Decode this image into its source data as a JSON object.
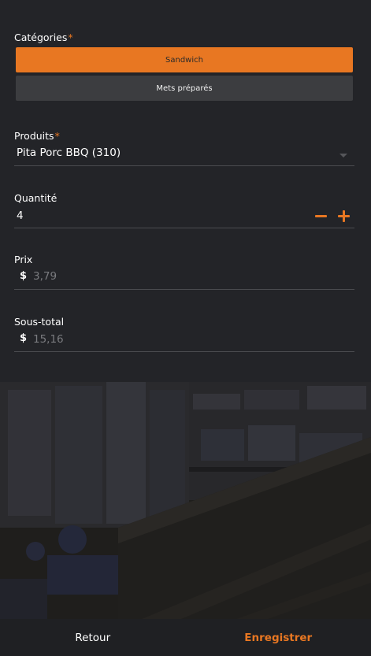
{
  "colors": {
    "accent": "#e87722",
    "background": "#232428",
    "inactive_button": "#3c3d40"
  },
  "categories": {
    "label": "Catégories",
    "required_mark": "*",
    "options": [
      {
        "label": "Sandwich",
        "selected": true
      },
      {
        "label": "Mets préparés",
        "selected": false
      }
    ]
  },
  "product": {
    "label": "Produits",
    "required_mark": "*",
    "value": "Pita Porc BBQ (310)",
    "icon": "chevron-down-icon"
  },
  "quantity": {
    "label": "Quantité",
    "value": "4",
    "decrement_icon": "minus-icon",
    "increment_icon": "plus-icon"
  },
  "price": {
    "label": "Prix",
    "currency": "$",
    "value": "3,79"
  },
  "subtotal": {
    "label": "Sous-total",
    "currency": "$",
    "value": "15,16"
  },
  "footer": {
    "back_label": "Retour",
    "save_label": "Enregistrer"
  }
}
